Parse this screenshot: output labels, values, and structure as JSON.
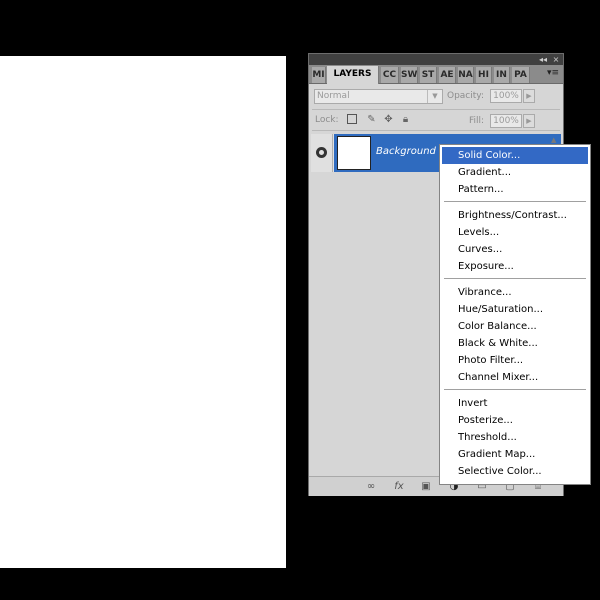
{
  "panel": {
    "tabs": [
      "MI",
      "LAYERS",
      "CC",
      "SW",
      "ST",
      "AE",
      "NA",
      "HI",
      "IN",
      "PA"
    ],
    "menu_glyph": "▾≡",
    "collapse_glyph": "◂◂",
    "close_glyph": "×"
  },
  "options": {
    "blend_mode": "Normal",
    "opacity_label": "Opacity:",
    "opacity_value": "100%",
    "lock_label": "Lock:",
    "fill_label": "Fill:",
    "fill_value": "100%"
  },
  "layers": [
    {
      "name": "Background",
      "visible": true,
      "selected": true
    }
  ],
  "bottom_icons": [
    "link-layers-icon",
    "fx-icon",
    "add-mask-icon",
    "adjustment-layer-icon",
    "group-icon",
    "new-layer-icon",
    "trash-icon"
  ],
  "bottom_glyphs": {
    "link": "∞",
    "fx": "fx",
    "mask": "▣",
    "adjust": "◑",
    "group": "▭",
    "new": "▢",
    "trash": "⌸"
  },
  "adjustment_menu": {
    "highlight_color": "#3369c5",
    "items": [
      "Solid Color...",
      "Gradient...",
      "Pattern...",
      "Brightness/Contrast...",
      "Levels...",
      "Curves...",
      "Exposure...",
      "Vibrance...",
      "Hue/Saturation...",
      "Color Balance...",
      "Black & White...",
      "Photo Filter...",
      "Channel Mixer...",
      "Invert",
      "Posterize...",
      "Threshold...",
      "Gradient Map...",
      "Selective Color..."
    ]
  }
}
